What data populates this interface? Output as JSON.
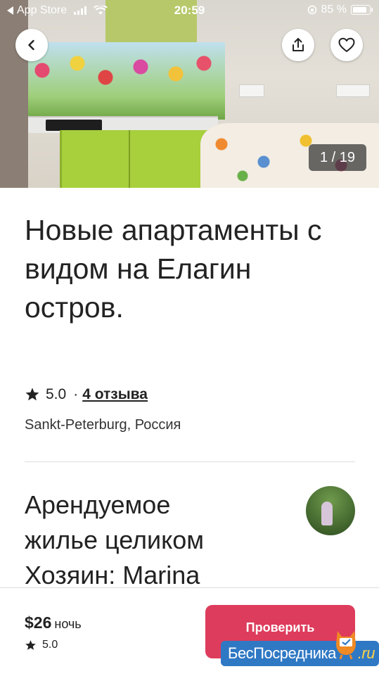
{
  "status_bar": {
    "back_app": "App Store",
    "time": "20:59",
    "battery": "85 %"
  },
  "gallery": {
    "counter": "1 / 19"
  },
  "listing": {
    "title": "Новые апартаменты с видом на Елагин остров.",
    "rating": "5.0",
    "rating_separator": "·",
    "reviews_link": "4 отзыва",
    "location": "Sankt-Peterburg, Россия"
  },
  "host": {
    "title_line1": "Арендуемое",
    "title_line2": "жилье целиком",
    "title_line3_prefix": "Хозяин:",
    "title_line3_name": "Marina"
  },
  "footer": {
    "price": "$26",
    "price_unit": "ночь",
    "rating": "5.0",
    "cta_label": "Проверить свободные даты"
  },
  "watermark": {
    "text": "БесПосредника",
    "suffix": ".ru"
  },
  "colors": {
    "accent": "#de3c5c",
    "text": "#222222",
    "watermark": "#2f78c4"
  },
  "icons": {
    "back": "chevron-left-icon",
    "share": "share-icon",
    "favorite": "heart-icon",
    "rating": "star-icon"
  }
}
